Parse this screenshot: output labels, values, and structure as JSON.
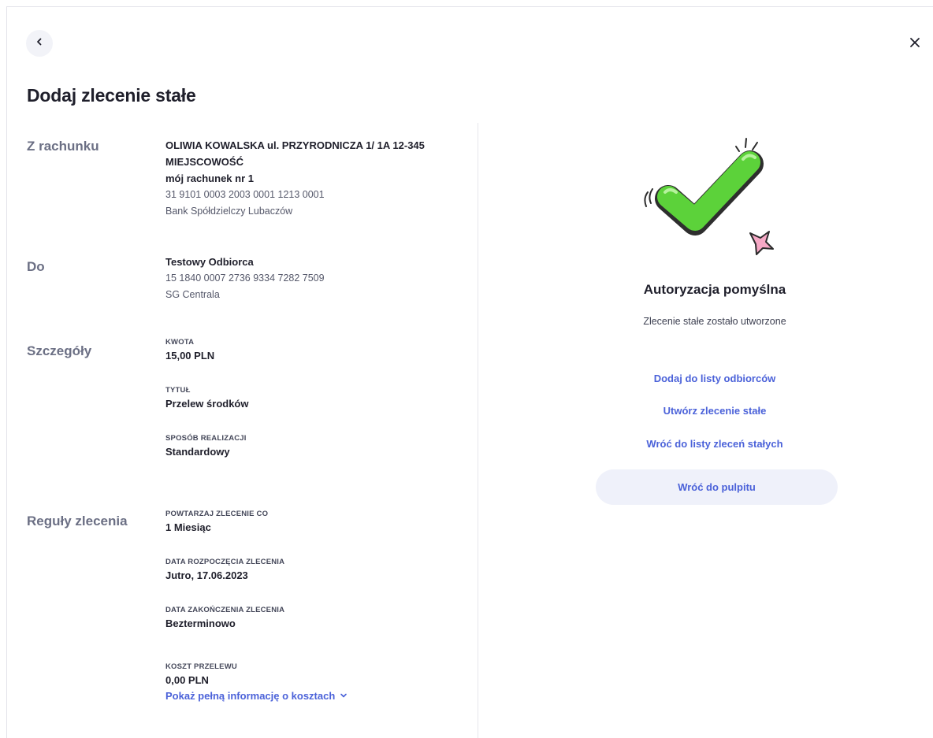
{
  "header": {
    "title": "Dodaj zlecenie stałe",
    "back_icon": "chevron-left-icon",
    "close_icon": "close-icon"
  },
  "from_account": {
    "label": "Z rachunku",
    "owner_line1": "OLIWIA KOWALSKA ul. PRZYRODNICZA 1/ 1A 12-345",
    "owner_line2": "MIEJSCOWOŚĆ",
    "account_name": "mój rachunek nr 1",
    "account_number": "31 9101 0003 2003 0001 1213 0001",
    "bank": "Bank Spółdzielczy Lubaczów"
  },
  "to": {
    "label": "Do",
    "recipient": "Testowy Odbiorca",
    "account_number": "15 1840 0007 2736 9334 7282 7509",
    "bank": "SG Centrala"
  },
  "details": {
    "label": "Szczegóły",
    "amount_caption": "KWOTA",
    "amount_value": "15,00 PLN",
    "title_caption": "TYTUŁ",
    "title_value": "Przelew środków",
    "method_caption": "SPOSÓB REALIZACJI",
    "method_value": "Standardowy"
  },
  "rules": {
    "label": "Reguły zlecenia",
    "repeat_caption": "POWTARZAJ ZLECENIE CO",
    "repeat_value": "1 Miesiąc",
    "start_caption": "DATA ROZPOCZĘCIA ZLECENIA",
    "start_value": "Jutro, 17.06.2023",
    "end_caption": "DATA ZAKOŃCZENIA ZLECENIA",
    "end_value": "Bezterminowo",
    "cost_caption": "KOSZT PRZELEWU",
    "cost_value": "0,00 PLN",
    "cost_link": "Pokaż pełną informację o kosztach",
    "cost_link_icon": "chevron-down-icon"
  },
  "result": {
    "icon": "success-checkmark-icon",
    "title": "Autoryzacja pomyślna",
    "subtitle": "Zlecenie stałe zostało utworzone",
    "link_add_recipient": "Dodaj do listy odbiorców",
    "link_create_order": "Utwórz zlecenie stałe",
    "link_back_list": "Wróć do listy zleceń stałych",
    "button_dashboard": "Wróć do pulpitu"
  },
  "colors": {
    "accent": "#4b62d9",
    "success_green": "#5cd23a",
    "label_gray": "#6b6f84"
  }
}
